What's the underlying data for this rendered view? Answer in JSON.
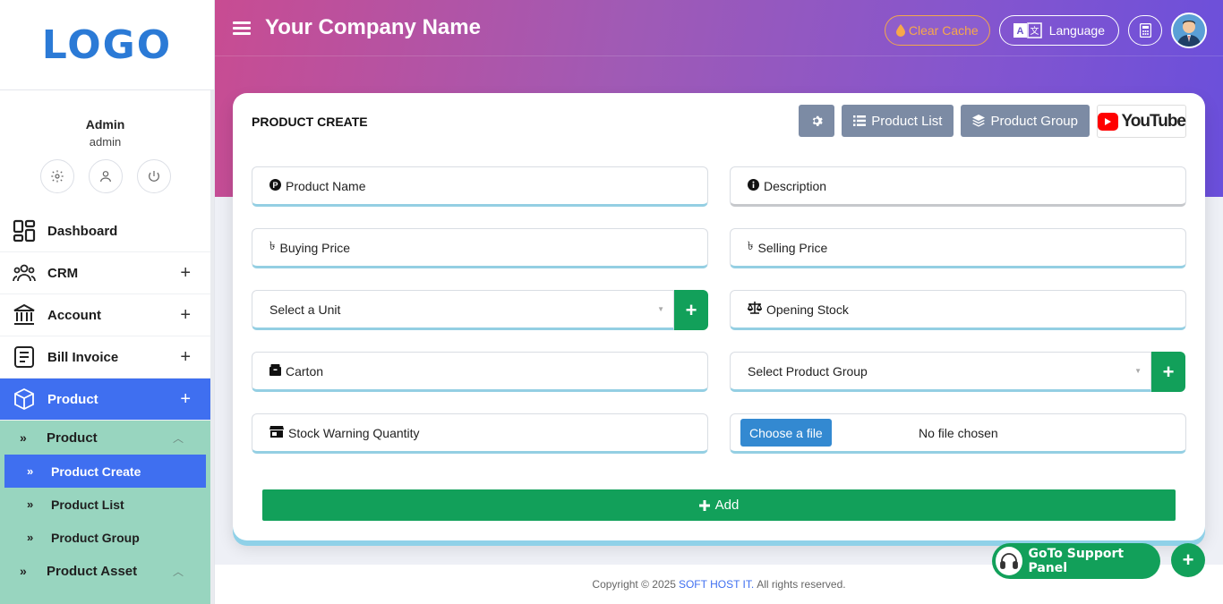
{
  "sidebar": {
    "logo": "LOGO",
    "user": {
      "name": "Admin",
      "role": "admin"
    },
    "nav": [
      {
        "label": "Dashboard",
        "icon": "dashboard-icon",
        "expandable": false
      },
      {
        "label": "CRM",
        "icon": "users-group-icon",
        "expandable": true
      },
      {
        "label": "Account",
        "icon": "bank-icon",
        "expandable": true
      },
      {
        "label": "Bill Invoice",
        "icon": "invoice-icon",
        "expandable": true
      },
      {
        "label": "Product",
        "icon": "box-icon",
        "expandable": true,
        "active": true
      }
    ],
    "submenu": {
      "group_product": "Product",
      "items": [
        "Product Create",
        "Product List",
        "Product Group"
      ],
      "group_asset": "Product Asset",
      "chevron": "»"
    }
  },
  "header": {
    "company": "Your Company Name",
    "clear_cache": "Clear Cache",
    "language": "Language"
  },
  "card": {
    "title": "PRODUCT CREATE",
    "tools": {
      "list": "Product List",
      "group": "Product Group",
      "youtube": "YouTube"
    },
    "fields": {
      "product_name": "Product Name",
      "description": "Description",
      "buying_price": "Buying Price",
      "selling_price": "Selling Price",
      "unit": "Select a Unit",
      "opening_stock": "Opening Stock",
      "carton": "Carton",
      "product_group": "Select Product Group",
      "stock_warning": "Stock Warning Quantity",
      "choose_file": "Choose a file",
      "no_file": "No file chosen",
      "currency_symbol": "৳"
    },
    "add_label": "Add"
  },
  "footer": {
    "prefix": "Copyright © 2025",
    "brand": "SOFT HOST IT.",
    "suffix": "All rights reserved."
  },
  "support": {
    "label": "GoTo Support Panel"
  },
  "colors": {
    "accent": "#3f6ff0",
    "success": "#12a05a",
    "submenu_bg": "#98d5bf"
  }
}
